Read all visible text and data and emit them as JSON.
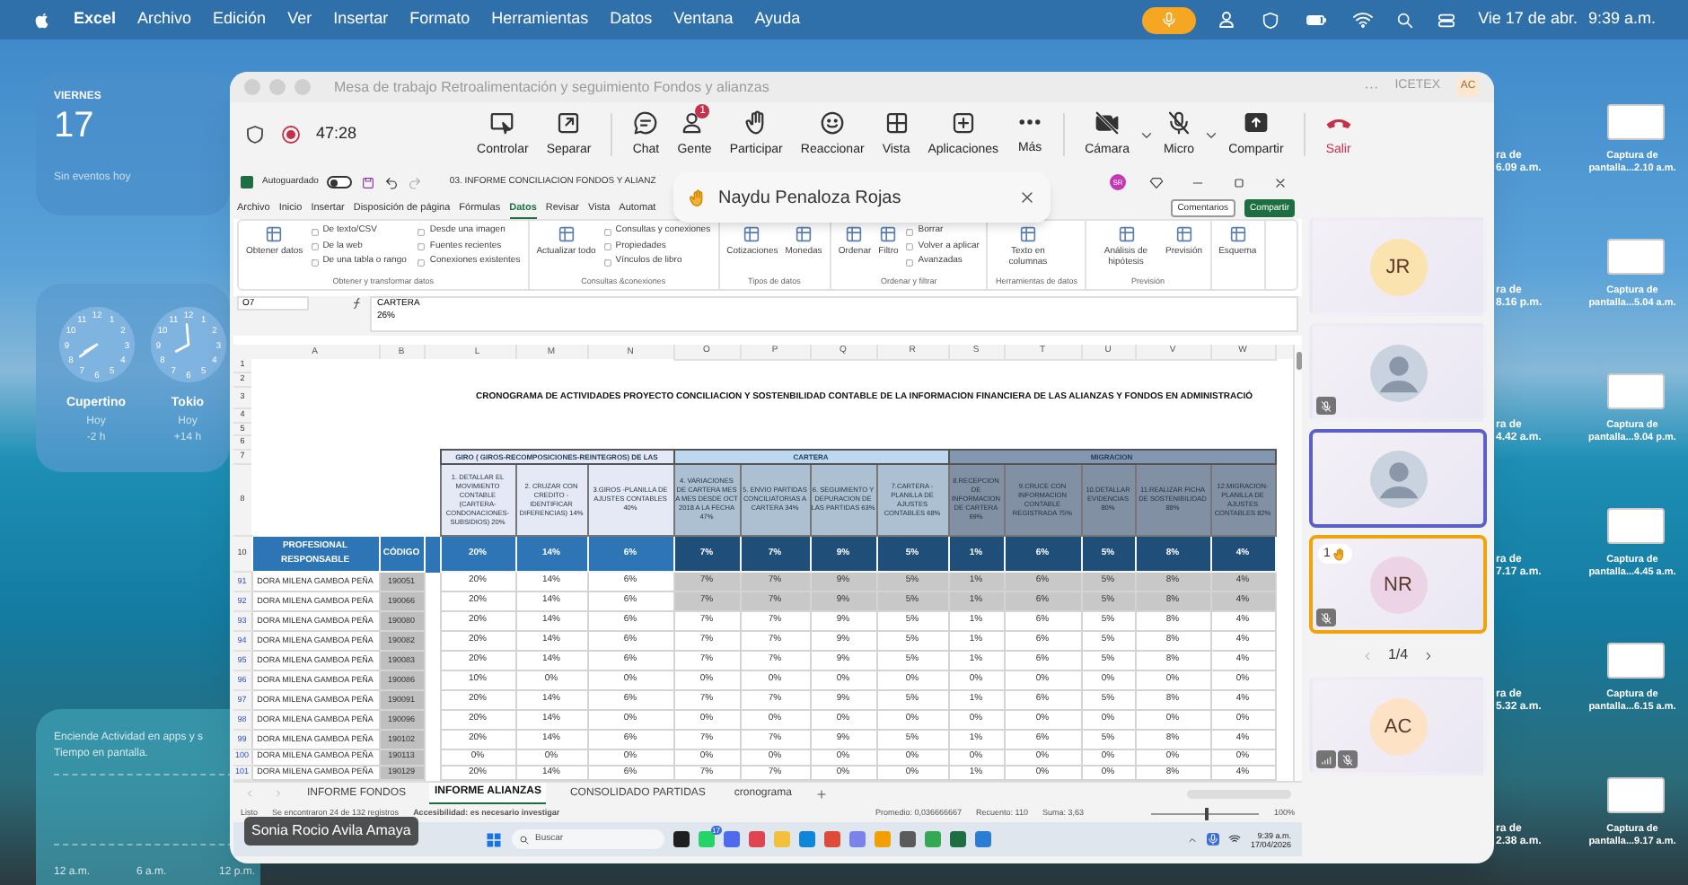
{
  "menu_bar": {
    "app": "Excel",
    "items": [
      "Archivo",
      "Edición",
      "Ver",
      "Insertar",
      "Formato",
      "Herramientas",
      "Datos",
      "Ventana",
      "Ayuda"
    ],
    "date": "Vie 17 de abr.",
    "time": "9:39 a.m."
  },
  "widgets": {
    "calendar": {
      "weekday": "VIERNES",
      "day": "17",
      "note": "Sin eventos hoy"
    },
    "clocks": [
      {
        "city": "Cupertino",
        "day": "Hoy",
        "offset": "-2 h",
        "numerals": [
          "11",
          "12",
          "1",
          "10",
          "2",
          "9",
          "3",
          "8",
          "4",
          "7",
          "6",
          "5"
        ]
      },
      {
        "city": "Tokio",
        "day": "Hoy",
        "offset": "+14 h",
        "numerals": [
          "11",
          "12",
          "1",
          "10",
          "2",
          "9",
          "3",
          "8",
          "4",
          "7",
          "6",
          "5"
        ]
      }
    ],
    "activity": {
      "lines": [
        "Enciende Actividad en apps y s",
        "Tiempo en pantalla."
      ],
      "ticks": [
        "12 a.m.",
        "6 a.m.",
        "12 p.m."
      ]
    }
  },
  "desktop_files": [
    {
      "left": [
        "ra de",
        "6.09 a.m."
      ],
      "right": [
        "Captura de",
        "pantalla...2.10 a.m."
      ]
    },
    {
      "left": [
        "ra de",
        "8.16 p.m."
      ],
      "right": [
        "Captura de",
        "pantalla...5.04 a.m."
      ]
    },
    {
      "left": [
        "ra de",
        "4.42 a.m."
      ],
      "right": [
        "Captura de",
        "pantalla...9.04 p.m."
      ]
    },
    {
      "left": [
        "ra de",
        "7.17 a.m."
      ],
      "right": [
        "Captura de",
        "pantalla...4.45 a.m."
      ]
    },
    {
      "left": [
        "ra de",
        "5.32 a.m."
      ],
      "right": [
        "Captura de",
        "pantalla...6.15 a.m."
      ]
    },
    {
      "left": [
        "ra de",
        "2.38 a.m."
      ],
      "right": [
        "Captura de",
        "pantalla...9.17 a.m."
      ]
    }
  ],
  "meeting": {
    "title": "Mesa de trabajo Retroalimentación y seguimiento Fondos y alianzas",
    "more": "···",
    "org": "ICETEX",
    "user_initials": "AC",
    "recording": true,
    "timer": "47:28",
    "toolbar": [
      {
        "kind": "control",
        "label": "Controlar"
      },
      {
        "kind": "popout",
        "label": "Separar"
      },
      {
        "kind": "chat",
        "label": "Chat"
      },
      {
        "kind": "people",
        "label": "Gente",
        "badge": "1"
      },
      {
        "kind": "raise",
        "label": "Participar"
      },
      {
        "kind": "react",
        "label": "Reaccionar"
      },
      {
        "kind": "view",
        "label": "Vista"
      },
      {
        "kind": "apps",
        "label": "Aplicaciones"
      },
      {
        "kind": "more",
        "label": "Más"
      },
      {
        "kind": "camera",
        "label": "Cámara",
        "off": true
      },
      {
        "kind": "mic",
        "label": "Micro",
        "off": true
      },
      {
        "kind": "share",
        "label": "Compartir"
      },
      {
        "kind": "leave",
        "label": "Salir"
      }
    ],
    "hand_toast": {
      "name": "Naydu Penaloza Rojas"
    },
    "presenter": "Sonia Rocio Avila Amaya",
    "participants": [
      {
        "kind": "initials",
        "initials": "JR",
        "color": "#fbe3b0",
        "muted": false,
        "speaking": false,
        "network": false
      },
      {
        "kind": "photo",
        "muted": true,
        "speaking": false,
        "network": false
      },
      {
        "kind": "photo",
        "muted": false,
        "speaking": true,
        "network": false
      },
      {
        "kind": "initials",
        "initials": "NR",
        "color": "#ecd3e6",
        "muted": true,
        "speaking": false,
        "hand": "1",
        "network": false
      }
    ],
    "pager": "1/4",
    "extra_participant": {
      "kind": "initials",
      "initials": "AC",
      "color": "#fde2c6",
      "muted": true,
      "speaking": false,
      "network": true
    }
  },
  "excel": {
    "autosave": "Autoguardado",
    "autosave_on": false,
    "file_title": "03. INFORME CONCILIACION FONDOS Y ALIANZ",
    "user": "SR",
    "tabs": [
      {
        "label": "Archivo",
        "selected": false
      },
      {
        "label": "Inicio",
        "selected": false
      },
      {
        "label": "Insertar",
        "selected": false
      },
      {
        "label": "Disposición de página",
        "selected": false
      },
      {
        "label": "Fórmulas",
        "selected": false
      },
      {
        "label": "Datos",
        "selected": true
      },
      {
        "label": "Revisar",
        "selected": false
      },
      {
        "label": "Vista",
        "selected": false
      },
      {
        "label": "Automat",
        "selected": false
      }
    ],
    "comments": "Comentarios",
    "share": "Compartir",
    "ribbon": [
      {
        "label": "Obtener y transformar datos",
        "large": [
          "Obtener datos"
        ],
        "small": [
          "De texto/CSV",
          "De la web",
          "De una tabla o rango",
          "Desde una imagen",
          "Fuentes recientes",
          "Conexiones existentes"
        ]
      },
      {
        "label": "Consultas &conexiones",
        "large": [
          "Actualizar todo"
        ],
        "small": [
          "Consultas y conexiones",
          "Propiedades",
          "Vínculos de libro"
        ]
      },
      {
        "label": "Tipos de datos",
        "large": [
          "Cotizaciones",
          "Monedas"
        ]
      },
      {
        "label": "Ordenar y filtrar",
        "large": [
          "Ordenar",
          "Filtro"
        ],
        "small": [
          "Borrar",
          "Volver a aplicar",
          "Avanzadas"
        ]
      },
      {
        "label": "Herramientas de datos",
        "large": [
          "Texto en columnas"
        ]
      },
      {
        "label": "Previsión",
        "large": [
          "Análisis de hipótesis",
          "Previsión"
        ]
      },
      {
        "large": [
          "Esquema"
        ]
      }
    ],
    "name_box": "O7",
    "formula": [
      "CARTERA",
      "26%"
    ],
    "columns": [
      "A",
      "B",
      "L",
      "M",
      "N",
      "O",
      "P",
      "Q",
      "R",
      "S",
      "T",
      "U",
      "V",
      "W"
    ],
    "top_rows": [
      "1",
      "2",
      "3",
      "4",
      "5",
      "6",
      "7",
      "8",
      "10"
    ],
    "title": "CRONOGRAMA DE ACTIVIDADES PROYECTO CONCILIACION Y SOSTENBILIDAD CONTABLE DE LA INFORMACION FINANCIERA DE LAS ALIANZAS Y FONDOS EN ADMINISTRACIÓ",
    "header_name": "PROFESIONAL RESPONSABLE",
    "header_code": "CÓDIGO",
    "groups": [
      {
        "label": "GIRO ( GIROS-RECOMPOSICIONES-REINTEGROS) DE LAS",
        "color": "#e4e9f5",
        "in_selection": false,
        "activities": [
          {
            "header": "1. DETALLAR EL MOVIMIENTO CONTABLE (CARTERA- CONDONACIONES- SUBSIDIOS) 20%",
            "weight": "20%"
          },
          {
            "header": "2. CRUZAR CON CREDITO - IDENTIFICAR DIFERENCIAS) 14%",
            "weight": "14%"
          },
          {
            "header": "3.GIROS -PLANILLA DE AJUSTES CONTABLES 40%",
            "weight": "6%"
          }
        ]
      },
      {
        "label": "CARTERA",
        "color": "#bdd7ee",
        "in_selection": true,
        "activities": [
          {
            "header": "4. VARIACIONES DE CARTERA MES A MES DESDE OCT 2018 A LA FECHA 47%",
            "weight": "7%"
          },
          {
            "header": "5. ENVIO PARTIDAS CONCILIATORIAS A CARTERA 34%",
            "weight": "7%"
          },
          {
            "header": "6. SEGUIMIENTO Y DEPURACION DE LAS PARTIDAS 63%",
            "weight": "9%"
          },
          {
            "header": "7.CARTERA - PLANILLA DE AJUSTES CONTABLES 68%",
            "weight": "5%"
          }
        ]
      },
      {
        "label": "MIGRACION",
        "color": "#8497b0",
        "in_selection": true,
        "activities": [
          {
            "header": "8.RECEPCION DE INFORMACION DE CARTERA 69%",
            "weight": "1%"
          },
          {
            "header": "9.CRUCE CON INFORMACION CONTABLE REGISTRADA 75%",
            "weight": "6%"
          },
          {
            "header": "10.DETALLAR EVIDENCIAS 80%",
            "weight": "5%"
          },
          {
            "header": "11.REALIZAR FICHA DE SOSTENIBILIDAD 88%",
            "weight": "8%"
          },
          {
            "header": "12.MIGRACION- PLANILLA DE AJUSTES CONTABLES 82%",
            "weight": "4%"
          }
        ]
      }
    ],
    "rows": [
      {
        "row": "91",
        "name": "DORA MILENA GAMBOA PEÑA",
        "code": "190051",
        "selected": true,
        "values": [
          "20%",
          "14%",
          "6%",
          "7%",
          "7%",
          "9%",
          "5%",
          "1%",
          "6%",
          "5%",
          "8%",
          "4%"
        ]
      },
      {
        "row": "92",
        "name": "DORA MILENA GAMBOA PEÑA",
        "code": "190066",
        "selected": true,
        "values": [
          "20%",
          "14%",
          "6%",
          "7%",
          "7%",
          "9%",
          "5%",
          "1%",
          "6%",
          "5%",
          "8%",
          "4%"
        ]
      },
      {
        "row": "93",
        "name": "DORA MILENA GAMBOA PEÑA",
        "code": "190080",
        "selected": false,
        "values": [
          "20%",
          "14%",
          "6%",
          "7%",
          "7%",
          "9%",
          "5%",
          "1%",
          "6%",
          "5%",
          "8%",
          "4%"
        ]
      },
      {
        "row": "94",
        "name": "DORA MILENA GAMBOA PEÑA",
        "code": "190082",
        "selected": false,
        "values": [
          "20%",
          "14%",
          "6%",
          "7%",
          "7%",
          "9%",
          "5%",
          "1%",
          "6%",
          "5%",
          "8%",
          "4%"
        ]
      },
      {
        "row": "95",
        "name": "DORA MILENA GAMBOA PEÑA",
        "code": "190083",
        "selected": false,
        "values": [
          "20%",
          "14%",
          "6%",
          "7%",
          "7%",
          "9%",
          "5%",
          "1%",
          "6%",
          "5%",
          "8%",
          "4%"
        ]
      },
      {
        "row": "96",
        "name": "DORA MILENA GAMBOA PEÑA",
        "code": "190086",
        "selected": false,
        "values": [
          "10%",
          "0%",
          "0%",
          "0%",
          "0%",
          "0%",
          "0%",
          "0%",
          "0%",
          "0%",
          "0%",
          "0%"
        ]
      },
      {
        "row": "97",
        "name": "DORA MILENA GAMBOA PEÑA",
        "code": "190091",
        "selected": false,
        "values": [
          "20%",
          "14%",
          "6%",
          "7%",
          "7%",
          "9%",
          "5%",
          "1%",
          "6%",
          "5%",
          "8%",
          "4%"
        ]
      },
      {
        "row": "98",
        "name": "DORA MILENA GAMBOA PEÑA",
        "code": "190096",
        "selected": false,
        "values": [
          "20%",
          "14%",
          "0%",
          "0%",
          "0%",
          "0%",
          "0%",
          "0%",
          "0%",
          "0%",
          "0%",
          "0%"
        ]
      },
      {
        "row": "99",
        "name": "DORA MILENA GAMBOA PEÑA",
        "code": "190102",
        "selected": false,
        "values": [
          "20%",
          "14%",
          "6%",
          "7%",
          "7%",
          "9%",
          "5%",
          "1%",
          "6%",
          "5%",
          "8%",
          "4%"
        ]
      },
      {
        "row": "100",
        "name": "DORA MILENA GAMBOA PEÑA",
        "code": "190113",
        "selected": false,
        "values": [
          "0%",
          "0%",
          "0%",
          "0%",
          "0%",
          "0%",
          "0%",
          "0%",
          "0%",
          "0%",
          "0%",
          "0%"
        ]
      },
      {
        "row": "101",
        "name": "DORA MILENA GAMBOA PEÑA",
        "code": "190129",
        "selected": false,
        "values": [
          "20%",
          "14%",
          "6%",
          "7%",
          "7%",
          "0%",
          "0%",
          "1%",
          "0%",
          "0%",
          "8%",
          "4%"
        ]
      }
    ],
    "sheet_tabs": [
      {
        "label": "INFORME FONDOS",
        "selected": false
      },
      {
        "label": "INFORME ALIANZAS",
        "selected": true
      },
      {
        "label": "CONSOLIDADO PARTIDAS",
        "selected": false
      },
      {
        "label": "cronograma",
        "selected": false
      }
    ],
    "status": {
      "ready": "Listo",
      "found": "Se encontraron 24 de 132 registros",
      "accessibility": "Accesibilidad: es necesario investigar",
      "average": "Promedio: 0,036666667",
      "count": "Recuento: 110",
      "sum": "Suma: 3,63",
      "zoom": "100%",
      "zoom_slider": {
        "level": 0.5
      }
    }
  },
  "taskbar": {
    "search": "Buscar",
    "apps": [
      {
        "color": "#1f1f1f"
      },
      {
        "color": "#25d366",
        "badge": "17"
      },
      {
        "color": "#4f6bed"
      },
      {
        "color": "#e0454f"
      },
      {
        "color": "#f3c03c"
      },
      {
        "color": "#0f86d6"
      },
      {
        "color": "#dd4b39"
      },
      {
        "color": "#7b83eb"
      },
      {
        "color": "#f29f05"
      },
      {
        "color": "#5a5a5a"
      },
      {
        "color": "#34a853"
      },
      {
        "color": "#1d6f42"
      },
      {
        "color": "#2b7cd3"
      }
    ],
    "time": "9:39 a.m.",
    "date": "17/04/2026"
  }
}
